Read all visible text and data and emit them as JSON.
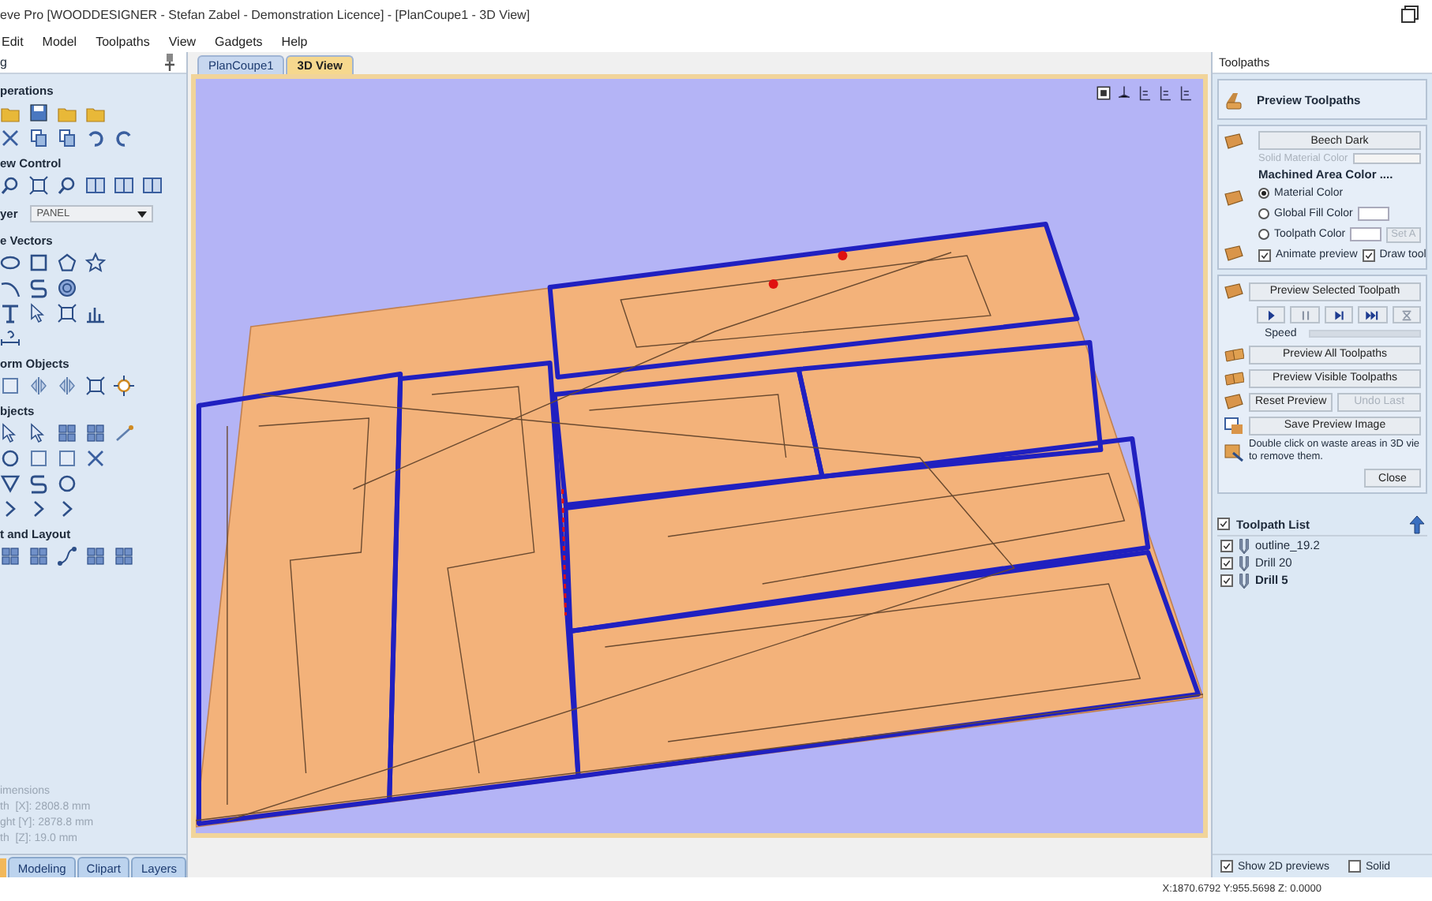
{
  "window": {
    "title": "eve Pro [WOODDESIGNER - Stefan Zabel - Demonstration Licence] - [PlanCoupe1 - 3D View]"
  },
  "menu": [
    "Edit",
    "Model",
    "Toolpaths",
    "View",
    "Gadgets",
    "Help"
  ],
  "left_panel": {
    "title": "g",
    "sections": [
      {
        "kind": "icons",
        "title": "perations"
      },
      {
        "kind": "icons",
        "title": "ew Control"
      },
      {
        "kind": "layer",
        "label": "yer",
        "value": "PANEL"
      },
      {
        "kind": "icons",
        "title": "e Vectors"
      },
      {
        "kind": "icons",
        "title": "orm Objects"
      },
      {
        "kind": "icons",
        "title": "bjects"
      },
      {
        "kind": "icons",
        "title": "t and Layout"
      }
    ],
    "dimensions": {
      "title": "imensions",
      "lines": [
        "th  [X]: 2808.8 mm",
        "ght [Y]: 2878.8 mm",
        "th  [Z]: 19.0 mm"
      ]
    },
    "tabs": [
      {
        "label": "Modeling",
        "selected": false
      },
      {
        "label": "Clipart",
        "selected": false
      },
      {
        "label": "Layers",
        "selected": false
      }
    ]
  },
  "view_tabs": [
    {
      "label": "PlanCoupe1",
      "selected": false
    },
    {
      "label": "3D View",
      "selected": true
    }
  ],
  "toolpaths_panel": {
    "title": "Toolpaths",
    "heading": "Preview Toolpaths",
    "material_button": "Beech Dark",
    "solid_color_label": "Solid Material Color",
    "machined_label": "Machined Area Color ....",
    "color_options": [
      {
        "label": "Material Color",
        "selected": true,
        "kind": "plain"
      },
      {
        "label": "Global Fill Color",
        "selected": false,
        "kind": "dropdown"
      },
      {
        "label": "Toolpath Color",
        "selected": false,
        "kind": "dropdown-button",
        "button": "Set A",
        "button_disabled": true
      }
    ],
    "checkboxes": [
      {
        "label": "Animate preview",
        "checked": true
      },
      {
        "label": "Draw tool",
        "checked": true
      }
    ],
    "preview_selected": "Preview Selected Toolpath",
    "speed": {
      "label": "Speed",
      "level": 1
    },
    "action_rows": [
      [
        {
          "label": "Preview All Toolpaths",
          "disabled": false
        }
      ],
      [
        {
          "label": "Preview Visible Toolpaths",
          "disabled": false
        }
      ],
      [
        {
          "label": "Reset Preview",
          "disabled": false
        },
        {
          "label": "Undo Last",
          "disabled": true
        }
      ],
      [
        {
          "label": "Save Preview Image",
          "disabled": false
        }
      ]
    ],
    "note": [
      "Double click on waste areas in 3D vie",
      "to remove them."
    ],
    "close": "Close"
  },
  "toolpath_list": {
    "title": "Toolpath List",
    "checked": true,
    "items": [
      {
        "name": "outline_19.2",
        "checked": true,
        "selected": false
      },
      {
        "name": "Drill 20",
        "checked": true,
        "selected": false
      },
      {
        "name": "Drill 5",
        "checked": true,
        "selected": true
      }
    ],
    "options": [
      {
        "label": "Show 2D previews",
        "checked": true
      },
      {
        "label": "Solid",
        "checked": false
      }
    ]
  },
  "status_bar": {
    "coords": "X:1870.6792 Y:955.5698 Z: 0.0000"
  }
}
